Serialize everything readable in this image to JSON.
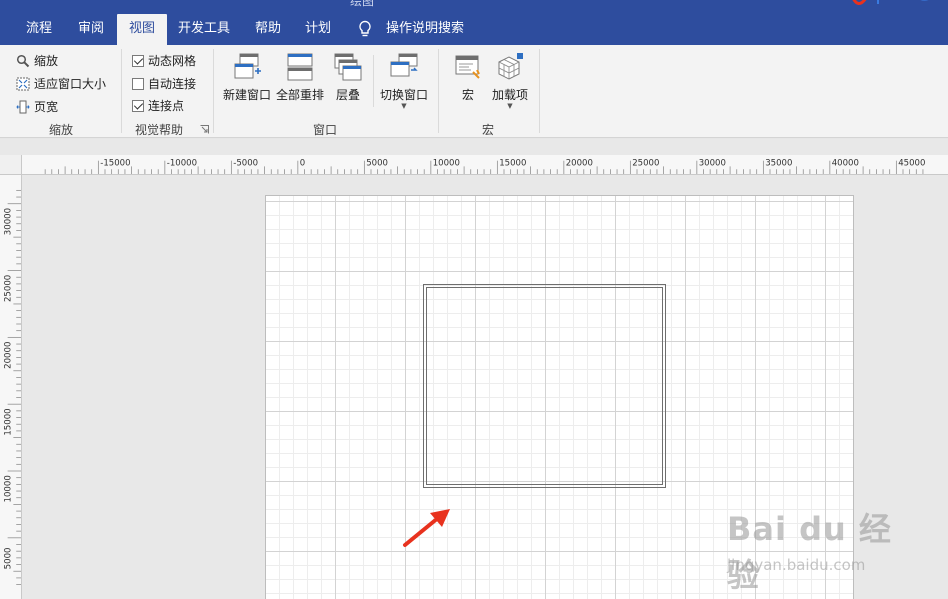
{
  "window": {
    "title_fragment": "绘图"
  },
  "tabs": [
    {
      "label": "流程",
      "active": false
    },
    {
      "label": "审阅",
      "active": false
    },
    {
      "label": "视图",
      "active": true
    },
    {
      "label": "开发工具",
      "active": false
    },
    {
      "label": "帮助",
      "active": false
    },
    {
      "label": "计划",
      "active": false
    }
  ],
  "tell_me": {
    "label": "操作说明搜索",
    "icon": "lightbulb-icon"
  },
  "ribbon": {
    "zoom_group": {
      "label": "缩放",
      "items": [
        {
          "label": "缩放",
          "icon": "magnifier-icon"
        },
        {
          "label": "适应窗口大小",
          "icon": "fit-window-icon"
        },
        {
          "label": "页宽",
          "icon": "page-width-icon"
        }
      ]
    },
    "visual_aids_group": {
      "label": "视觉帮助",
      "checks": [
        {
          "label": "动态网格",
          "checked": true
        },
        {
          "label": "自动连接",
          "checked": false
        },
        {
          "label": "连接点",
          "checked": true
        }
      ]
    },
    "window_group": {
      "label": "窗口",
      "buttons": [
        {
          "label": "新建窗口",
          "icon": "new-window-icon"
        },
        {
          "label": "全部重排",
          "icon": "arrange-all-icon"
        },
        {
          "label": "层叠",
          "icon": "cascade-icon"
        },
        {
          "label": "切换窗口",
          "icon": "switch-windows-icon"
        }
      ]
    },
    "macros_group": {
      "label": "宏",
      "buttons": [
        {
          "label": "宏",
          "icon": "macro-icon"
        },
        {
          "label": "加载项",
          "icon": "add-ins-icon"
        }
      ]
    }
  },
  "rulers": {
    "horizontal_labels": [
      "-15000",
      "-10000",
      "-5000",
      "0",
      "5000",
      "10000",
      "15000",
      "20000",
      "25000",
      "30000",
      "35000",
      "40000",
      "45000"
    ],
    "vertical_labels": [
      "30000",
      "25000",
      "20000",
      "15000",
      "10000",
      "5000"
    ]
  },
  "watermark": {
    "brand": "Bai du 经验",
    "url": "jingyan.baidu.com"
  },
  "colors": {
    "tab_bar": "#2e4d9e",
    "ribbon": "#f3f3f3",
    "arrow": "#e8321e",
    "shape_border": "#6e6e6e"
  }
}
